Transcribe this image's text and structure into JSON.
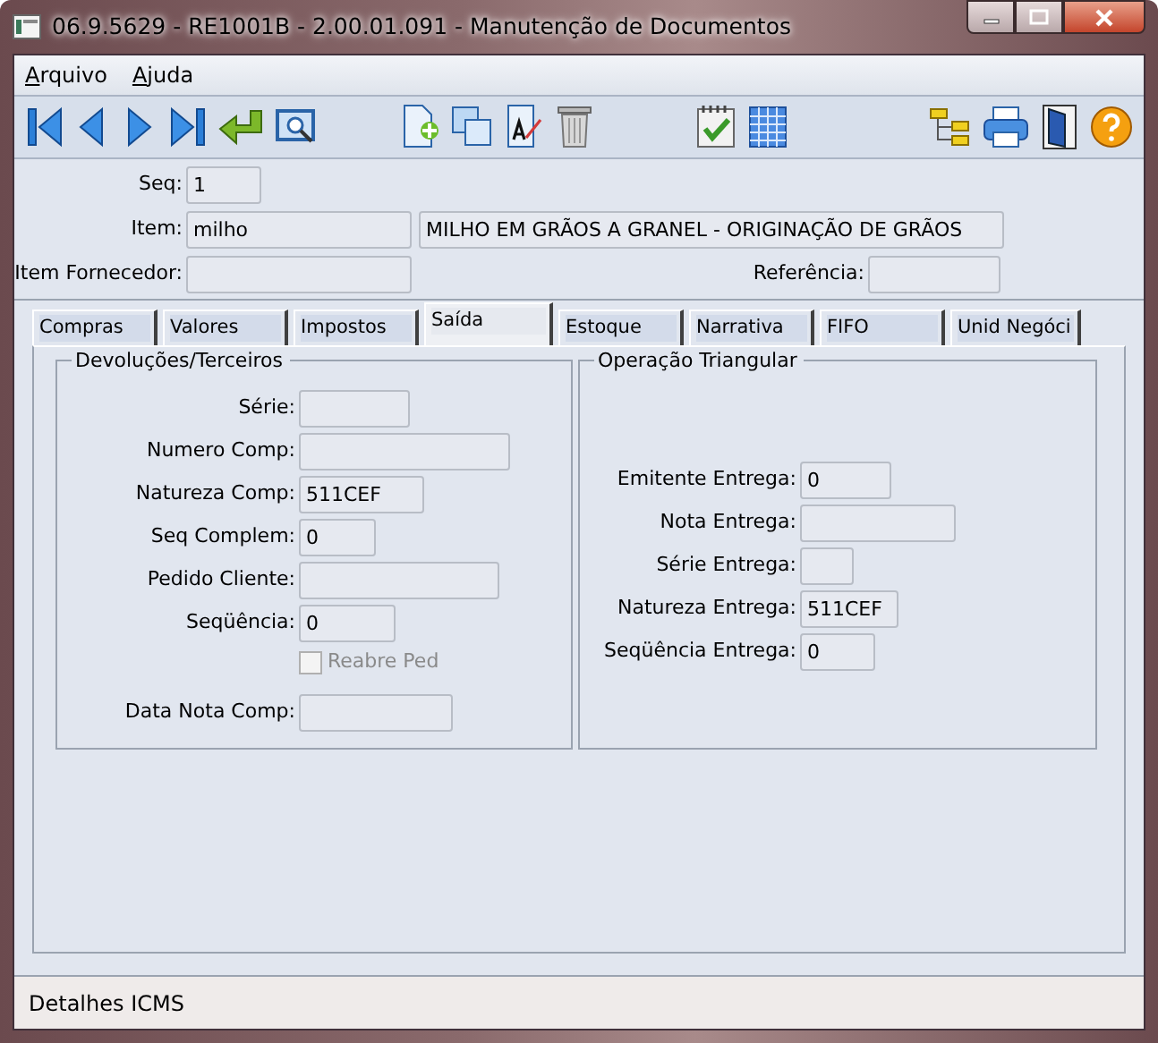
{
  "window": {
    "title": "06.9.5629 - RE1001B - 2.00.01.091 - Manutenção de Documentos"
  },
  "menu": [
    "Arquivo",
    "Ajuda"
  ],
  "header": {
    "seq": {
      "label": "Seq:",
      "value": "1"
    },
    "item": {
      "label": "Item:",
      "value": "milho",
      "description": "MILHO EM GRÃOS A GRANEL - ORIGINAÇÃO DE GRÃOS"
    },
    "item_fornecedor": {
      "label": "Item Fornecedor:"
    },
    "referencia": {
      "label": "Referência:"
    }
  },
  "tabs": [
    {
      "label": "Compras",
      "selected": false
    },
    {
      "label": "Valores",
      "selected": false
    },
    {
      "label": "Impostos",
      "selected": false
    },
    {
      "label": "Saída",
      "selected": true
    },
    {
      "label": "Estoque",
      "selected": false
    },
    {
      "label": "Narrativa",
      "selected": false
    },
    {
      "label": "FIFO",
      "selected": false
    },
    {
      "label": "Unid Negóci",
      "selected": false
    }
  ],
  "groups": [
    {
      "title": "Devoluções/Terceiros",
      "rows": [
        {
          "kind": "field",
          "label": "Série:"
        },
        {
          "kind": "field",
          "label": "Numero Comp:"
        },
        {
          "kind": "field",
          "label": "Natureza Comp:",
          "value": "511CEF"
        },
        {
          "kind": "field",
          "label": "Seq Complem:",
          "value": "0"
        },
        {
          "kind": "field",
          "label": "Pedido Cliente:"
        },
        {
          "kind": "field",
          "label": "Seqüência:",
          "value": "0"
        },
        {
          "kind": "checkbox",
          "label": "Reabre Ped",
          "checked": false,
          "disabled": true
        },
        {
          "kind": "field",
          "label": "Data Nota Comp:"
        }
      ]
    },
    {
      "title": "Operação Triangular",
      "rows": [
        {
          "kind": "field",
          "label": "Emitente Entrega:",
          "value": "0"
        },
        {
          "kind": "field",
          "label": "Nota Entrega:"
        },
        {
          "kind": "field",
          "label": "Série Entrega:"
        },
        {
          "kind": "field",
          "label": "Natureza Entrega:",
          "value": "511CEF"
        },
        {
          "kind": "field",
          "label": "Seqüência Entrega:",
          "value": "0"
        }
      ]
    }
  ],
  "status_bar": "Detalhes ICMS"
}
